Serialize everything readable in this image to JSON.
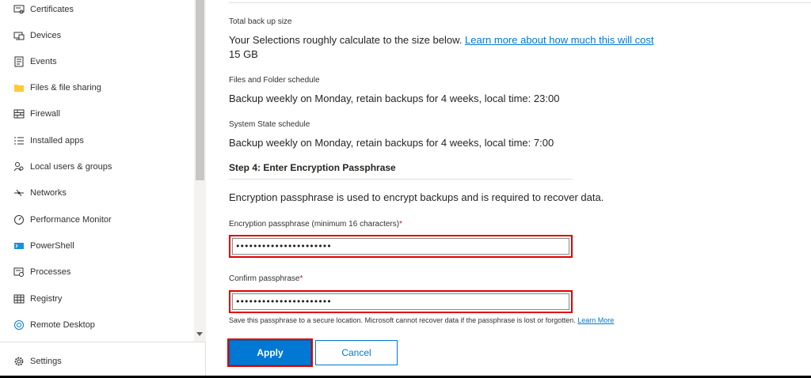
{
  "sidebar": {
    "items": [
      {
        "label": "Certificates",
        "icon": "certificate-icon"
      },
      {
        "label": "Devices",
        "icon": "devices-icon"
      },
      {
        "label": "Events",
        "icon": "events-icon"
      },
      {
        "label": "Files & file sharing",
        "icon": "folder-icon"
      },
      {
        "label": "Firewall",
        "icon": "firewall-icon"
      },
      {
        "label": "Installed apps",
        "icon": "list-icon"
      },
      {
        "label": "Local users & groups",
        "icon": "users-icon"
      },
      {
        "label": "Networks",
        "icon": "network-icon"
      },
      {
        "label": "Performance Monitor",
        "icon": "gauge-icon"
      },
      {
        "label": "PowerShell",
        "icon": "powershell-icon"
      },
      {
        "label": "Processes",
        "icon": "processes-icon"
      },
      {
        "label": "Registry",
        "icon": "registry-icon"
      },
      {
        "label": "Remote Desktop",
        "icon": "remote-desktop-icon"
      }
    ],
    "settings_label": "Settings"
  },
  "main": {
    "total_backup_label": "Total back up size",
    "total_backup_text": "Your Selections roughly calculate to the size below.",
    "total_backup_link": "Learn more about how much this will cost",
    "total_backup_value": "15 GB",
    "files_schedule_label": "Files and Folder schedule",
    "files_schedule_value": "Backup weekly on Monday, retain backups for 4 weeks, local time: 23:00",
    "system_schedule_label": "System State schedule",
    "system_schedule_value": "Backup weekly on Monday, retain backups for 4 weeks, local time: 7:00",
    "step_title": "Step 4: Enter Encryption Passphrase",
    "step_description": "Encryption passphrase is used to encrypt backups and is required to recover data.",
    "passphrase_label": "Encryption passphrase (minimum 16 characters)",
    "passphrase_value": "••••••••••••••••••••••",
    "confirm_label": "Confirm passphrase",
    "confirm_value": "••••••••••••••••••••••",
    "required_marker": "*",
    "helper_text": "Save this passphrase to a secure location. Microsoft cannot recover data if the passphrase is lost or forgotten.",
    "helper_link": "Learn More",
    "apply_label": "Apply",
    "cancel_label": "Cancel"
  },
  "colors": {
    "accent": "#0078d4",
    "highlight": "#e00000",
    "required": "#a4262c"
  }
}
